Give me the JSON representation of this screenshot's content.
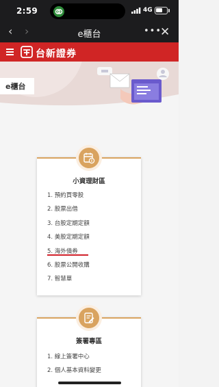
{
  "status_bar": {
    "time": "2:59",
    "network": "4G"
  },
  "browser": {
    "title": "e櫃台",
    "back_icon": "chevron-left-icon",
    "forward_icon": "chevron-right-icon",
    "more_icon": "more-dots-icon",
    "close_icon": "close-icon"
  },
  "site": {
    "brand": "台新證券",
    "menu_icon": "hamburger-icon",
    "logo_icon": "taishin-logo-icon"
  },
  "banner": {
    "title": "e櫃台"
  },
  "sections": [
    {
      "title": "小資理財區",
      "icon": "calendar-money-icon",
      "items": [
        "1. 預約買零股",
        "2. 股票出借",
        "3. 台股定期定額",
        "4. 美股定期定額",
        "5. 海外債券",
        "6. 股票公開收購",
        "7. 智慧單"
      ]
    },
    {
      "title": "簽署專區",
      "icon": "sign-document-icon",
      "items": [
        "1. 線上簽署中心",
        "2. 個人基本資料變更"
      ]
    }
  ],
  "colors": {
    "brand_red": "#d02525",
    "accent_gold": "#d9a35f",
    "underline_red": "#d0202a"
  }
}
